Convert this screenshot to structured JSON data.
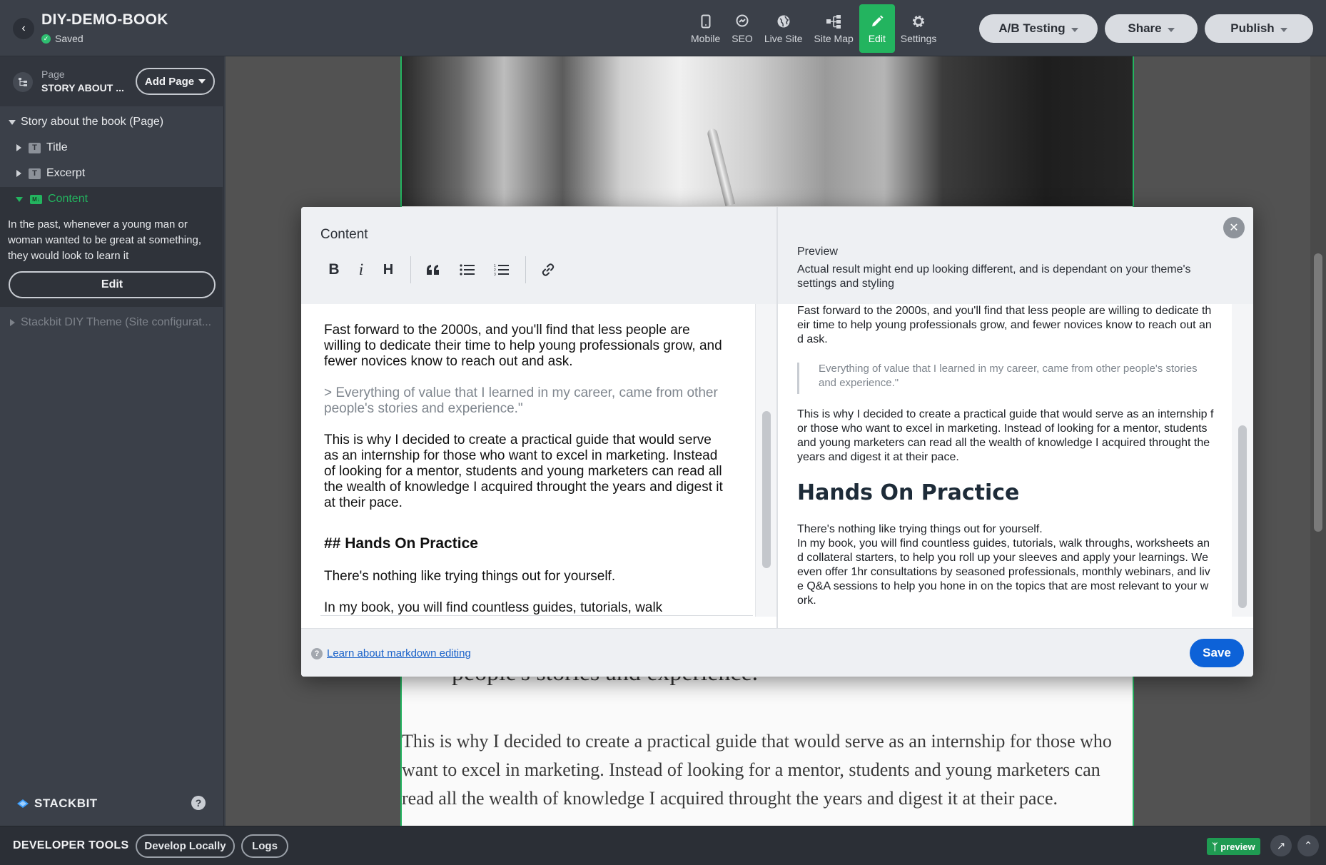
{
  "header": {
    "project_title": "DIY-DEMO-BOOK",
    "saved_label": "Saved",
    "tools": [
      {
        "label": "Mobile",
        "icon": "mobile-icon"
      },
      {
        "label": "SEO",
        "icon": "seo-icon"
      },
      {
        "label": "Live Site",
        "icon": "globe-icon"
      },
      {
        "label": "Site Map",
        "icon": "sitemap-icon"
      },
      {
        "label": "Edit",
        "icon": "pencil-icon",
        "active": true
      },
      {
        "label": "Settings",
        "icon": "gear-icon"
      }
    ],
    "ab_testing": "A/B Testing",
    "share": "Share",
    "publish": "Publish",
    "accent_color": "#23b45f"
  },
  "sidebar": {
    "page_label": "Page",
    "page_name": "STORY ABOUT ...",
    "add_page": "Add Page",
    "tree": {
      "root": "Story about the book (Page)",
      "title": "Title",
      "excerpt": "Excerpt",
      "content": "Content",
      "content_preview": "In the past, whenever a young man or woman wanted to be great at something, they would look to learn it",
      "edit_button": "Edit",
      "theme": "Stackbit DIY Theme (Site configurat..."
    },
    "logo": "STACKBIT",
    "help": "?"
  },
  "canvas": {
    "quote_tail": "people's stories and experience.\"",
    "paragraph": "This is why I decided to create a practical guide that would serve as an internship for those who want to excel in marketing. Instead of looking for a mentor, students and young marketers can read all the wealth of knowledge I acquired throught the years and digest it at their pace."
  },
  "modal": {
    "editor_title": "Content",
    "toolbar": {
      "bold": "B",
      "italic": "i",
      "heading": "H"
    },
    "editor": {
      "p1": "Fast forward to the 2000s, and you'll find that less people are willing to dedicate their time to help young professionals grow, and fewer novices know to reach out and ask.",
      "quote": "> Everything of value that I learned in my career, came from other people's stories and experience.\"",
      "p2": "This is why I decided to create a practical guide that would serve as an internship for those who want to excel in marketing. Instead of looking for a mentor, students and young marketers can read all the wealth of knowledge I acquired throught the years and digest it at their pace.",
      "heading": "## Hands On Practice",
      "p3": "There's nothing like trying things out for yourself.",
      "p4": "In my book, you will find countless guides, tutorials, walk"
    },
    "preview": {
      "title": "Preview",
      "note": "Actual result might end up looking different, and is dependant on your theme's settings and styling",
      "p1": "Fast forward to the 2000s, and you'll find that less people are willing to dedicate their time to help young professionals grow, and fewer novices know to reach out and ask.",
      "quote": "Everything of value that I learned in my career, came from other people's stories and experience.\"",
      "p2": "This is why I decided to create a practical guide that would serve as an internship for those who want to excel in marketing. Instead of looking for a mentor, students and young marketers can read all the wealth of knowledge I acquired throught the years and digest it at their pace.",
      "heading": "Hands On Practice",
      "p3": "There's nothing like trying things out for yourself.",
      "p4": "In my book, you will find countless guides, tutorials, walk throughs, worksheets and collateral starters, to help you roll up your sleeves and apply your learnings. We even offer 1hr consultations by seasoned professionals, monthly webinars, and live Q&A sessions to help you hone in on the topics that are most relevant to your work."
    },
    "footer_link": "Learn about markdown editing",
    "save": "Save"
  },
  "devbar": {
    "title": "DEVELOPER TOOLS",
    "develop_locally": "Develop Locally",
    "logs": "Logs",
    "branch": "preview"
  }
}
